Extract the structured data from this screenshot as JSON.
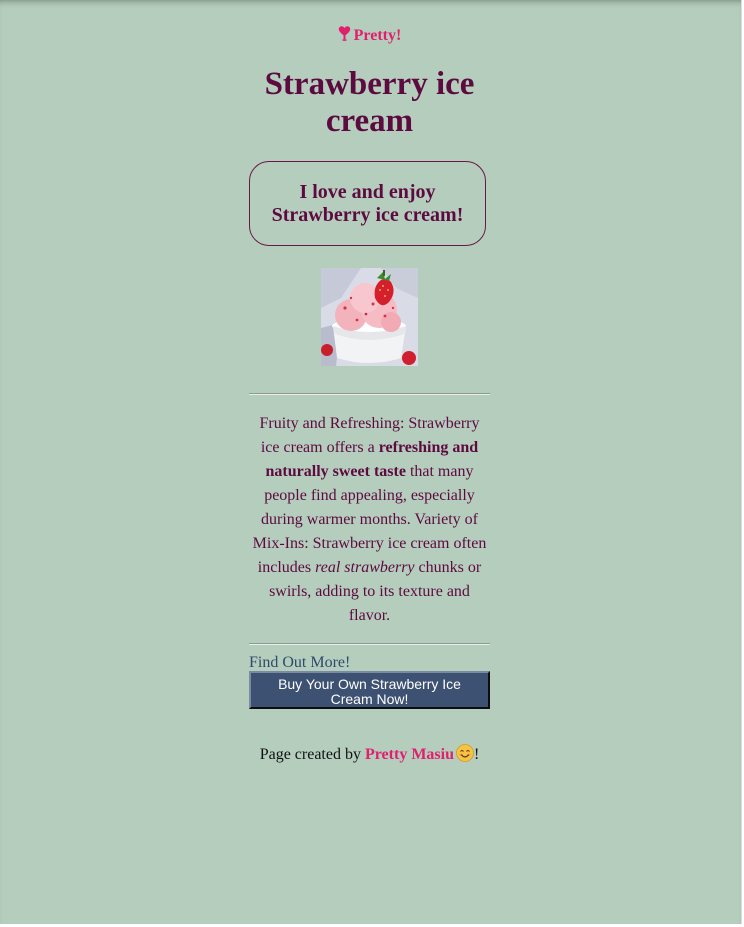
{
  "brand": {
    "label": "Pretty!",
    "icon": "heart-pin-icon",
    "color": "#e0206d"
  },
  "page": {
    "title": "Strawberry ice cream",
    "tagline": "I love and enjoy Strawberry ice cream!",
    "background": "#b5cdbd",
    "text_color": "#5c0a3f"
  },
  "photo": {
    "subject": "strawberry-ice-cream-bowl"
  },
  "description": {
    "part1": "Fruity and Refreshing: Strawberry ice cream offers a ",
    "bold": "refreshing and naturally sweet taste",
    "part2": " that many people find appealing, especially during warmer months. Variety of Mix-Ins: Strawberry ice cream often includes ",
    "italic": "real strawberry",
    "part3": " chunks or swirls, adding to its texture and flavor."
  },
  "links": {
    "find_out_more": "Find Out More!"
  },
  "buy_button": {
    "label": "Buy Your Own Strawberry Ice Cream Now!",
    "background": "#3d5172"
  },
  "footer": {
    "prefix": "Page created by ",
    "author": "Pretty Masiu",
    "emoji": "smiling-face-icon",
    "suffix": "!"
  }
}
